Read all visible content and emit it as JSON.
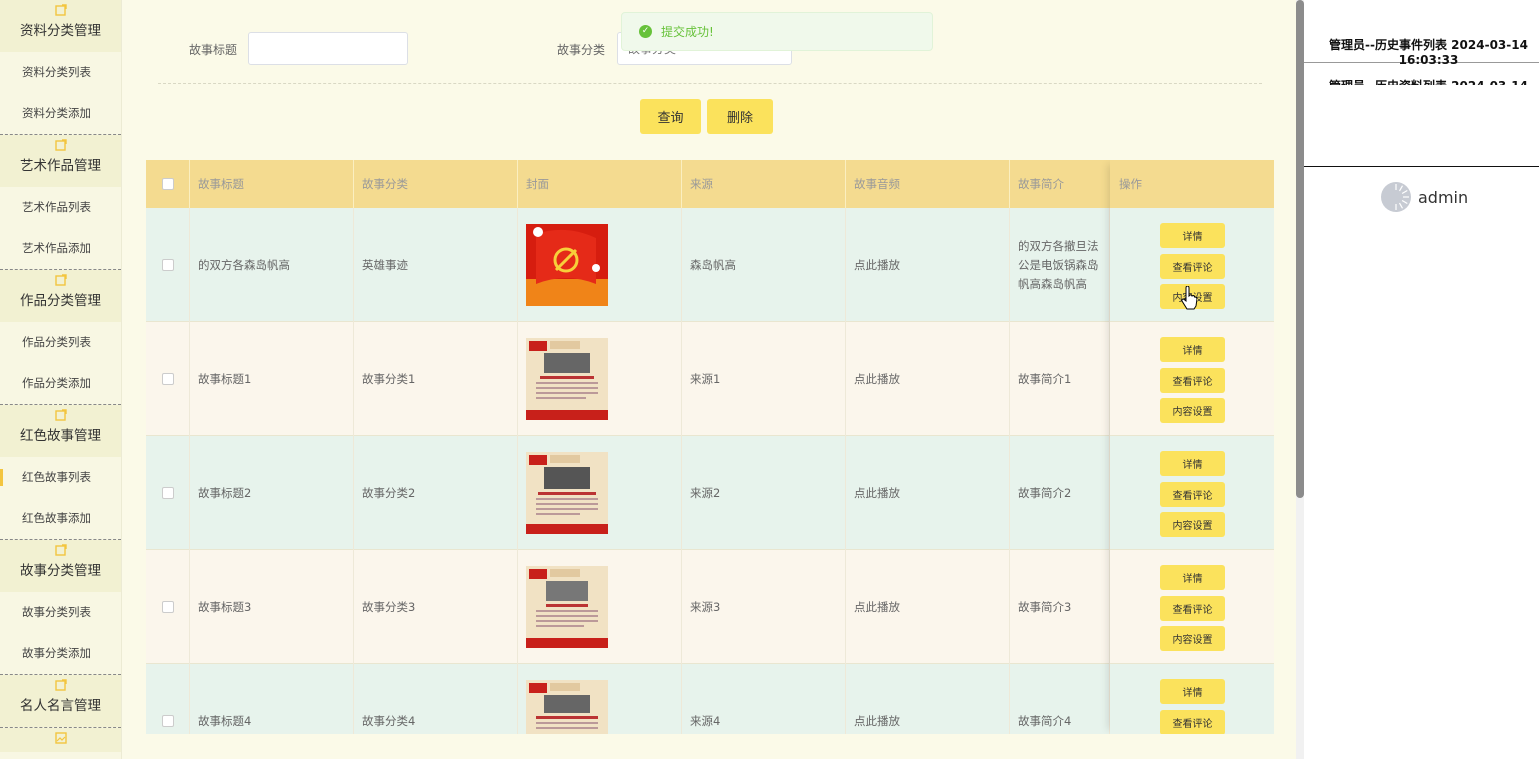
{
  "sidebar": {
    "groups": [
      {
        "title": "资料分类管理",
        "items": [
          "资料分类列表",
          "资料分类添加"
        ]
      },
      {
        "title": "艺术作品管理",
        "items": [
          "艺术作品列表",
          "艺术作品添加"
        ]
      },
      {
        "title": "作品分类管理",
        "items": [
          "作品分类列表",
          "作品分类添加"
        ]
      },
      {
        "title": "红色故事管理",
        "items": [
          "红色故事列表",
          "红色故事添加"
        ]
      },
      {
        "title": "故事分类管理",
        "items": [
          "故事分类列表",
          "故事分类添加"
        ]
      },
      {
        "title": "名人名言管理",
        "items": []
      }
    ],
    "active_item": "红色故事列表"
  },
  "search": {
    "title_label": "故事标题",
    "title_value": "",
    "category_label": "故事分类",
    "category_placeholder": "故事分类"
  },
  "buttons": {
    "query": "查询",
    "delete": "删除"
  },
  "toast": {
    "message": "提交成功!"
  },
  "table": {
    "headers": {
      "title": "故事标题",
      "category": "故事分类",
      "cover": "封面",
      "source": "来源",
      "audio": "故事音频",
      "intro": "故事简介",
      "ops": "操作"
    },
    "rows": [
      {
        "title": "的双方各森岛帆高",
        "category": "英雄事迹",
        "source": "森岛帆高",
        "audio": "点此播放",
        "intro": "的双方各撤旦法公是电饭锅森岛帆高森岛帆高"
      },
      {
        "title": "故事标题1",
        "category": "故事分类1",
        "source": "来源1",
        "audio": "点此播放",
        "intro": "故事简介1"
      },
      {
        "title": "故事标题2",
        "category": "故事分类2",
        "source": "来源2",
        "audio": "点此播放",
        "intro": "故事简介2"
      },
      {
        "title": "故事标题3",
        "category": "故事分类3",
        "source": "来源3",
        "audio": "点此播放",
        "intro": "故事简介3"
      },
      {
        "title": "故事标题4",
        "category": "故事分类4",
        "source": "来源4",
        "audio": "点此播放",
        "intro": "故事简介4"
      }
    ],
    "op_buttons": {
      "detail": "详情",
      "comments": "查看评论",
      "content": "内容设置"
    }
  },
  "history": [
    {
      "text": "管理员--历史事件列表 2024-03-14 16:03:33"
    },
    {
      "text": "管理员--历史资料列表 2024-03-14"
    }
  ],
  "user": {
    "name": "admin"
  },
  "colors": {
    "accent": "#fbe25c",
    "header": "#f4db90",
    "row_even": "#e7f3ec",
    "row_odd": "#fbf6ec",
    "success": "#67c23a"
  }
}
